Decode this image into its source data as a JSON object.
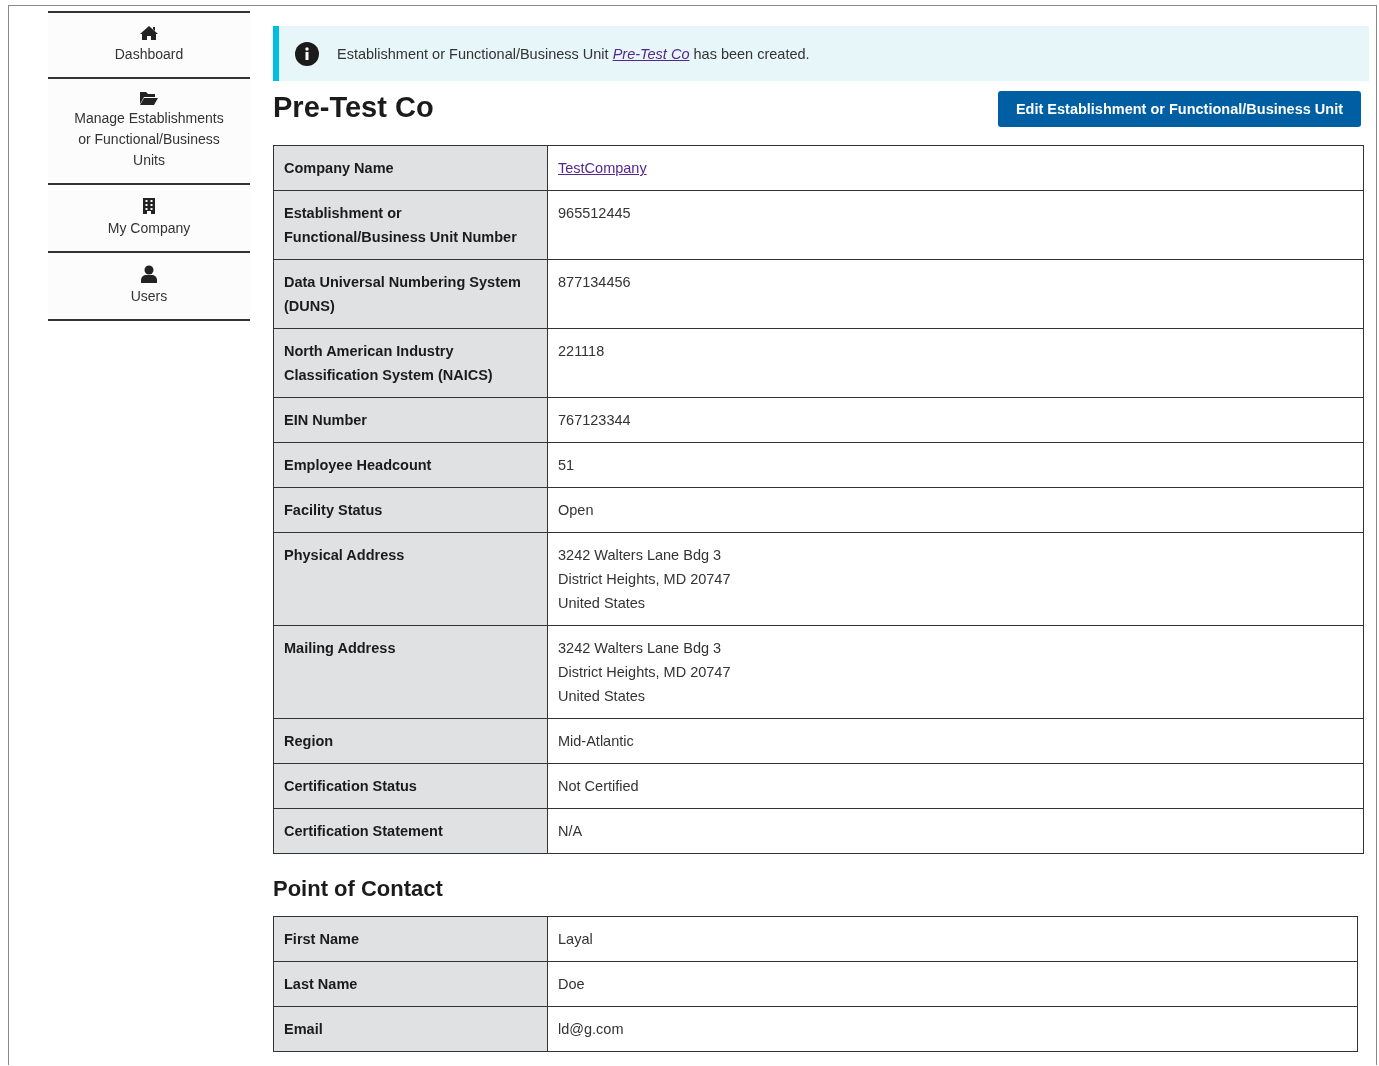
{
  "sidebar": {
    "items": [
      {
        "kind": "home",
        "label": "Dashboard"
      },
      {
        "kind": "folder",
        "label": "Manage Establishments or Functional/Business Units"
      },
      {
        "kind": "building",
        "label": "My Company"
      },
      {
        "kind": "user",
        "label": "Users"
      }
    ]
  },
  "alert": {
    "before": "Establishment or Functional/Business Unit ",
    "link": "Pre-Test Co",
    "after": " has been created."
  },
  "title": "Pre-Test Co",
  "edit_button": "Edit Establishment or Functional/Business Unit",
  "details": [
    {
      "label": "Company Name",
      "kind": "link",
      "value": [
        "TestCompany"
      ]
    },
    {
      "label": "Establishment or Functional/Business Unit Number",
      "kind": "text",
      "value": [
        "965512445"
      ]
    },
    {
      "label": "Data Universal Numbering System (DUNS)",
      "kind": "text",
      "value": [
        "877134456"
      ]
    },
    {
      "label": "North American Industry Classification System (NAICS)",
      "kind": "text",
      "value": [
        "221118"
      ]
    },
    {
      "label": "EIN Number",
      "kind": "text",
      "value": [
        "767123344"
      ]
    },
    {
      "label": "Employee Headcount",
      "kind": "text",
      "value": [
        "51"
      ]
    },
    {
      "label": "Facility Status",
      "kind": "text",
      "value": [
        "Open"
      ]
    },
    {
      "label": "Physical Address",
      "kind": "text",
      "value": [
        "3242 Walters Lane Bdg 3",
        "District Heights, MD 20747",
        "United States"
      ]
    },
    {
      "label": "Mailing Address",
      "kind": "text",
      "value": [
        "3242 Walters Lane Bdg 3",
        "District Heights, MD 20747",
        "United States"
      ]
    },
    {
      "label": "Region",
      "kind": "text",
      "value": [
        "Mid-Atlantic"
      ]
    },
    {
      "label": "Certification Status",
      "kind": "text",
      "value": [
        "Not Certified"
      ]
    },
    {
      "label": "Certification Statement",
      "kind": "text",
      "value": [
        "N/A"
      ]
    }
  ],
  "contact_heading": "Point of Contact",
  "contact": [
    {
      "label": "First Name",
      "kind": "text",
      "value": [
        "Layal"
      ]
    },
    {
      "label": "Last Name",
      "kind": "text",
      "value": [
        "Doe"
      ]
    },
    {
      "label": "Email",
      "kind": "text",
      "value": [
        "ld@g.com"
      ]
    }
  ]
}
